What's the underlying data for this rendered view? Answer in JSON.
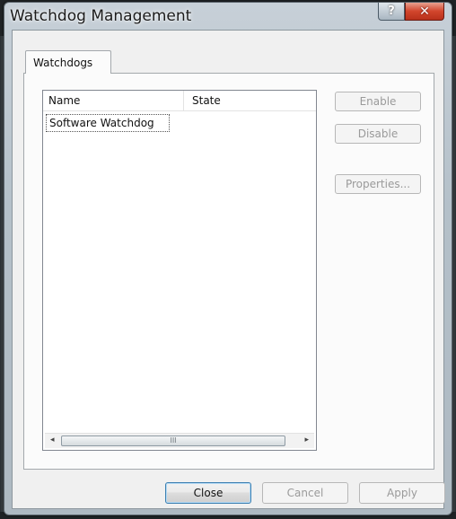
{
  "window": {
    "title": "Watchdog Management",
    "help_glyph": "?",
    "close_glyph": "✕"
  },
  "tabs": [
    {
      "label": "Watchdogs",
      "selected": true
    }
  ],
  "list": {
    "columns": [
      "Name",
      "State"
    ],
    "rows": [
      {
        "name": "Software Watchdog",
        "state": ""
      }
    ],
    "scroll_left_glyph": "◂",
    "scroll_right_glyph": "▸",
    "scroll_thumb_grip": "III"
  },
  "side_buttons": {
    "enable": "Enable",
    "disable": "Disable",
    "properties": "Properties..."
  },
  "footer": {
    "close": "Close",
    "cancel": "Cancel",
    "apply": "Apply"
  },
  "colors": {
    "titlebar": "#b4c0c9",
    "close_button": "#d2452c",
    "default_button_border": "#3c7fb1",
    "disabled_text": "#9a9a9a"
  }
}
